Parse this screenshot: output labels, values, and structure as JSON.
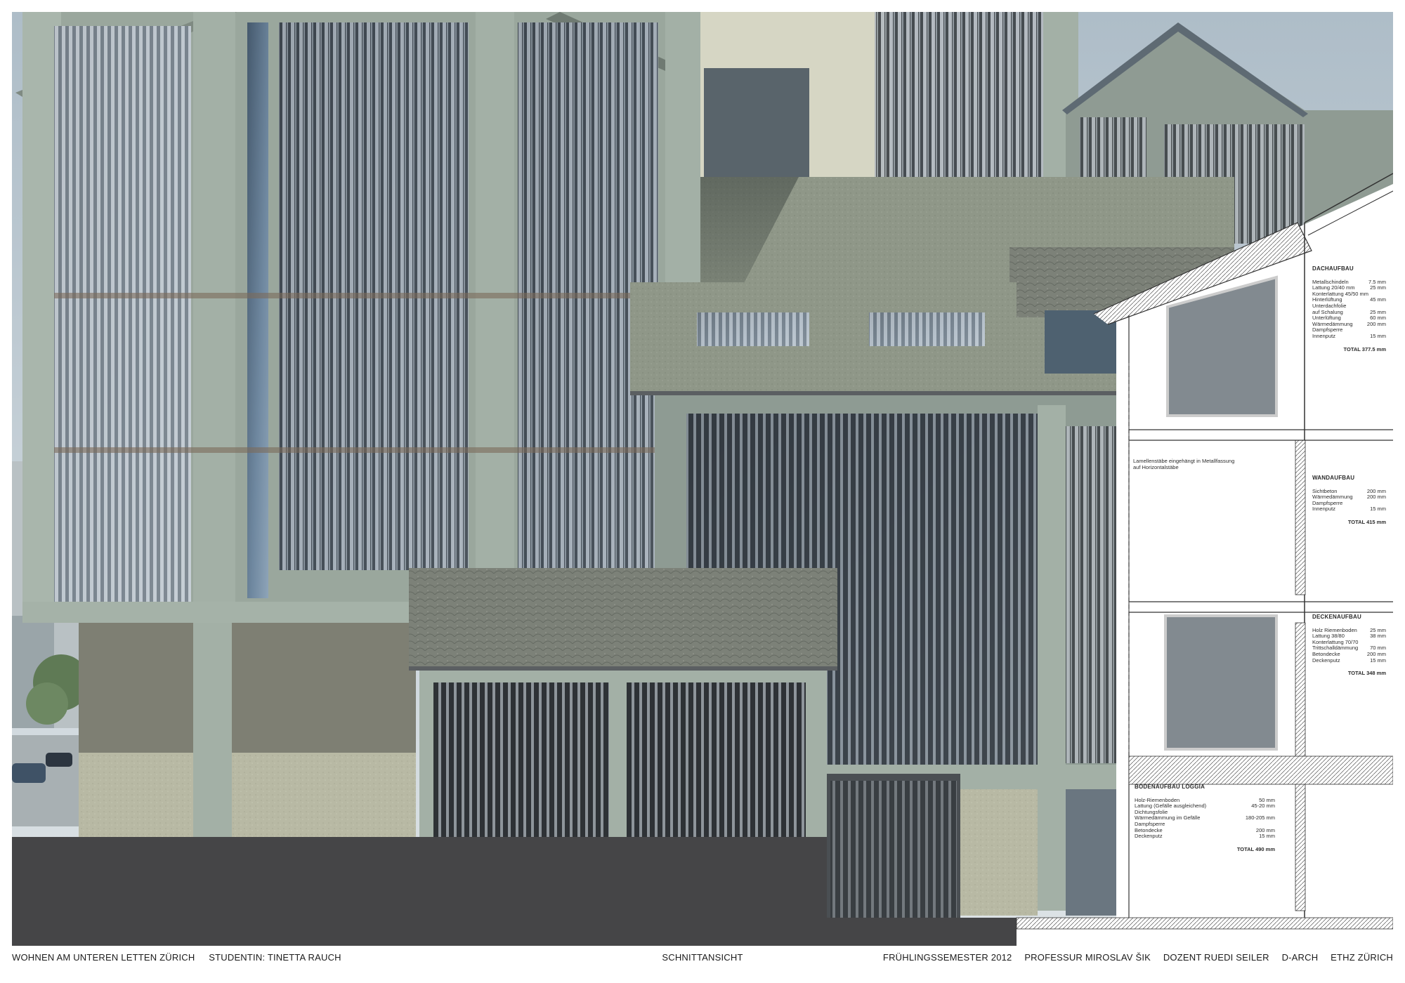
{
  "footer": {
    "project": "WOHNEN AM UNTEREN LETTEN ZÜRICH",
    "student": "STUDENTIN: TINETTA RAUCH",
    "drawing": "SCHNITTANSICHT",
    "semester": "FRÜHLINGSSEMESTER  2012",
    "professor": "PROFESSUR MIROSLAV ŠIK",
    "lecturer": "DOZENT RUEDI SEILER",
    "department": "D-ARCH",
    "school": "ETHZ ZÜRICH"
  },
  "section": {
    "louver_note": [
      "Lamellenstäbe eingehängt in Metallfassung",
      "auf Horizontalstäbe"
    ],
    "dachaufbau": {
      "title": "DACHAUFBAU",
      "rows": [
        {
          "label": "Metallschindeln",
          "value": "7.5 mm"
        },
        {
          "label": "Lattung 20/40 mm",
          "value": "25 mm"
        },
        {
          "label": "Konterlattung 45/50 mm",
          "value": ""
        },
        {
          "label": "Hinterlüftung",
          "value": "45 mm"
        },
        {
          "label": "Unterdachfolie",
          "value": ""
        },
        {
          "label": "auf Schalung",
          "value": "25 mm"
        },
        {
          "label": "Unterlüftung",
          "value": "60 mm"
        },
        {
          "label": "Wärmedämmung",
          "value": "200 mm"
        },
        {
          "label": "Dampfsperre",
          "value": ""
        },
        {
          "label": "Innenputz",
          "value": "15 mm"
        }
      ],
      "total": "TOTAL  377.5 mm"
    },
    "wandaufbau": {
      "title": "WANDAUFBAU",
      "rows": [
        {
          "label": "Sichtbeton",
          "value": "200 mm"
        },
        {
          "label": "Wärmedämmung",
          "value": "200 mm"
        },
        {
          "label": "Dampfsperre",
          "value": ""
        },
        {
          "label": "Innenputz",
          "value": "15 mm"
        }
      ],
      "total": "TOTAL  415 mm"
    },
    "deckenaufbau": {
      "title": "DECKENAUFBAU",
      "rows": [
        {
          "label": "Holz Riemenboden",
          "value": "25 mm"
        },
        {
          "label": "Lattung 38/80",
          "value": "38 mm"
        },
        {
          "label": "Konterlattung 70/70",
          "value": ""
        },
        {
          "label": "Trittschalldämmung",
          "value": "70 mm"
        },
        {
          "label": "Betondecke",
          "value": "200 mm"
        },
        {
          "label": "Deckenputz",
          "value": "15 mm"
        }
      ],
      "total": "TOTAL  348 mm"
    },
    "bodenaufbau": {
      "title": "BODENAUFBAU LOGGIA",
      "rows": [
        {
          "label": "Holz-Riemenboden",
          "value": "50 mm"
        },
        {
          "label": "Lattung (Gefälle ausgleichend)",
          "value": "45-20 mm"
        },
        {
          "label": "Dichtungsfolie",
          "value": ""
        },
        {
          "label": "Wärmedämmung im Gefälle",
          "value": "180-205 mm"
        },
        {
          "label": "Dampfsperre",
          "value": ""
        },
        {
          "label": "Betondecke",
          "value": "200 mm"
        },
        {
          "label": "Deckenputz",
          "value": "15 mm"
        }
      ],
      "total": "TOTAL  490 mm"
    }
  }
}
